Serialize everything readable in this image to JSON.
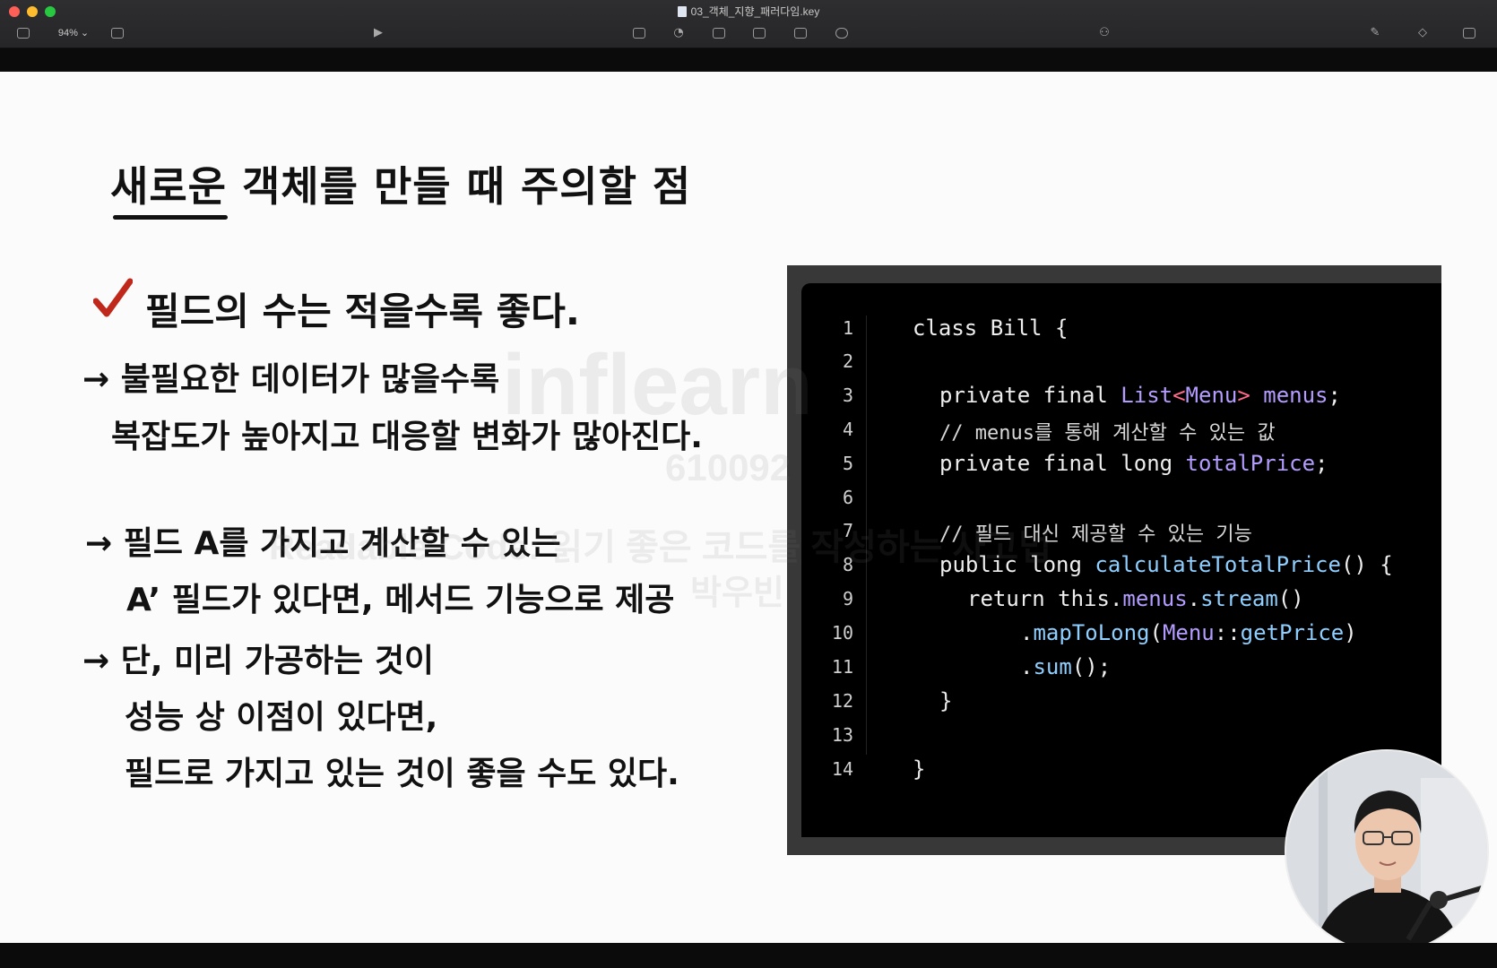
{
  "window": {
    "doc_title": "03_객체_지향_패러다임.key",
    "zoom": "94%",
    "colors": {
      "titlebar": "#2b2b2d",
      "slide_bg": "#fbfbfb",
      "code_bg": "#000000"
    }
  },
  "toolbar": {
    "icons": [
      "sidebar-icon",
      "add-slide-icon",
      "play-icon",
      "table-icon",
      "chart-icon",
      "text-icon",
      "shape-icon",
      "media-icon",
      "comment-icon",
      "collaborate-icon",
      "format-icon",
      "animate-icon",
      "document-icon"
    ]
  },
  "slide": {
    "title": "새로운 객체를 만들 때 주의할 점",
    "check_text": "필드의 수는 적을수록 좋다.",
    "bullets": [
      {
        "line1": "→ 불필요한 데이터가 많을수록",
        "line2": "복잡도가 높아지고 대응할 변화가 많아진다."
      },
      {
        "line1": "→ 필드 A를 가지고 계산할 수 있는",
        "line2": "A’ 필드가 있다면, 메서드 기능으로 제공"
      },
      {
        "line1": "→ 단, 미리 가공하는 것이",
        "line2": "성능 상 이점이 있다면,",
        "line3": "필드로 가지고 있는 것이 좋을 수도 있다."
      }
    ]
  },
  "code": {
    "line_numbers": [
      "1",
      "2",
      "3",
      "4",
      "5",
      "6",
      "7",
      "8",
      "9",
      "10",
      "11",
      "12",
      "13",
      "14"
    ],
    "lines": {
      "l1": "class Bill {",
      "l3_a": "private final ",
      "l3_b": "List",
      "l3_c": "<",
      "l3_d": "Menu",
      "l3_e": ">",
      "l3_f": " menus",
      "l3_g": ";",
      "l4": "// menus를 통해 계산할 수 있는 값",
      "l5_a": "private final long ",
      "l5_b": "totalPrice",
      "l5_c": ";",
      "l7": "// 필드 대신 제공할 수 있는 기능",
      "l8_a": "public long ",
      "l8_b": "calculateTotalPrice",
      "l8_c": "() {",
      "l9_a": "return this.",
      "l9_b": "menus",
      "l9_c": ".",
      "l9_d": "stream",
      "l9_e": "()",
      "l10_a": ".",
      "l10_b": "mapToLong",
      "l10_c": "(",
      "l10_d": "Menu",
      "l10_e": "::",
      "l10_f": "getPrice",
      "l10_g": ")",
      "l11_a": ".",
      "l11_b": "sum",
      "l11_c": "();",
      "l12": "}",
      "l14": "}"
    }
  },
  "watermark": {
    "logo": "inflearn",
    "id": "610092",
    "course": "Readable Code: 읽기 좋은 코드를 작성하는 사고법",
    "author": "박우빈"
  }
}
